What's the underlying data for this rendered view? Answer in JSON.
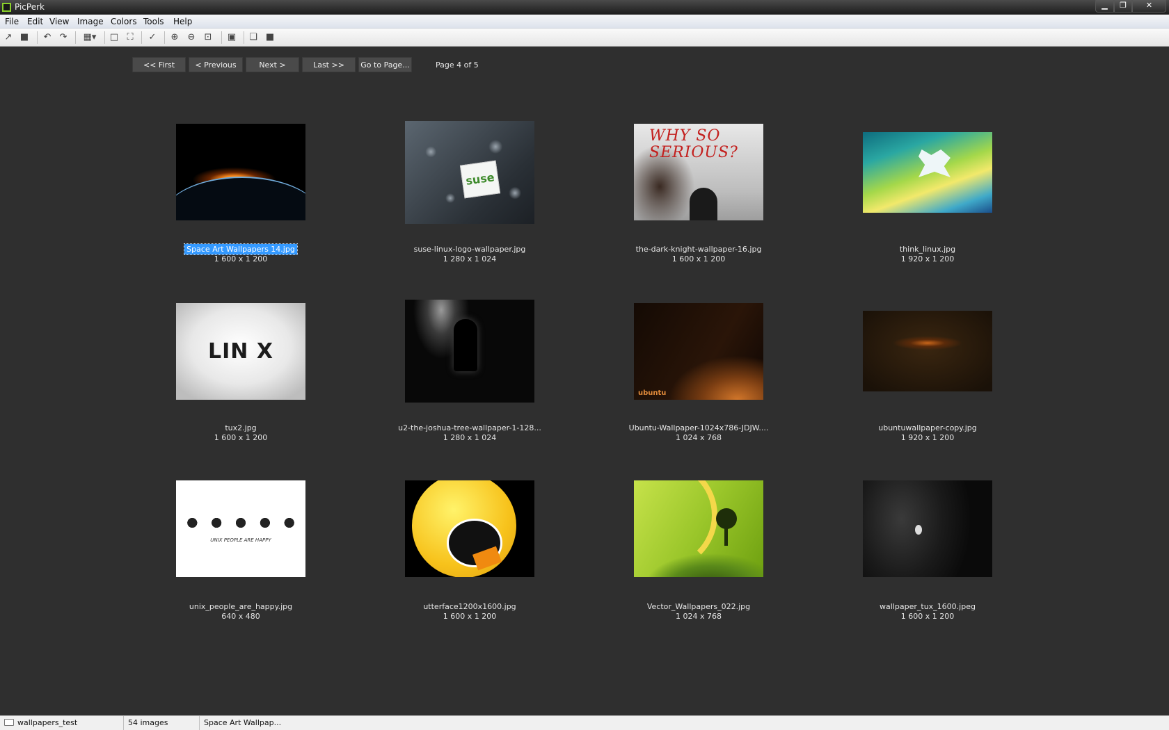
{
  "window": {
    "title": "PicPerk",
    "min_glyph": "▁",
    "max_glyph": "❐",
    "close_glyph": "✕"
  },
  "menu": [
    "File",
    "Edit",
    "View",
    "Image",
    "Colors",
    "Tools",
    "Help"
  ],
  "toolbar_icons": {
    "open": "↗",
    "save": "■",
    "undo": "↶",
    "redo": "↷",
    "grid": "▦▾",
    "select": "□",
    "fit": "⛶",
    "check": "✓",
    "zoom_in": "⊕",
    "zoom_out": "⊖",
    "zoom_fit": "⊡",
    "slideshow": "▣",
    "copy": "❏",
    "fullscreen": "■"
  },
  "pager": {
    "first": "<< First",
    "previous": "< Previous",
    "next": "Next >",
    "last": "Last >>",
    "goto": "Go to Page...",
    "indicator": "Page 4 of 5"
  },
  "thumbnails": [
    {
      "name": "Space Art Wallpapers 14.jpg",
      "dims": "1 600 x 1 200",
      "selected": true
    },
    {
      "name": "suse-linux-logo-wallpaper.jpg",
      "dims": "1 280 x 1 024"
    },
    {
      "name": "the-dark-knight-wallpaper-16.jpg",
      "dims": "1 600 x 1 200"
    },
    {
      "name": "think_linux.jpg",
      "dims": "1 920 x 1 200"
    },
    {
      "name": "tux2.jpg",
      "dims": "1 600 x 1 200"
    },
    {
      "name": "u2-the-joshua-tree-wallpaper-1-128...",
      "dims": "1 280 x 1 024"
    },
    {
      "name": "Ubuntu-Wallpaper-1024x786-JDJW....",
      "dims": "1 024 x 768"
    },
    {
      "name": "ubuntuwallpaper-copy.jpg",
      "dims": "1 920 x 1 200"
    },
    {
      "name": "unix_people_are_happy.jpg",
      "dims": "640 x 480"
    },
    {
      "name": "utterface1200x1600.jpg",
      "dims": "1 600 x 1 200"
    },
    {
      "name": "Vector_Wallpapers_022.jpg",
      "dims": "1 024 x 768"
    },
    {
      "name": "wallpaper_tux_1600.jpeg",
      "dims": "1 600 x 1 200"
    }
  ],
  "thumbnail_art": {
    "suse": "suse",
    "joker": "WHY SO SERIOUS?",
    "linux": "LIN X",
    "unix": "UNIX PEOPLE ARE HAPPY",
    "ubuntu": "ubuntu"
  },
  "status": {
    "folder": "wallpapers_test",
    "count": "54 images",
    "selected": "Space Art Wallpap..."
  }
}
